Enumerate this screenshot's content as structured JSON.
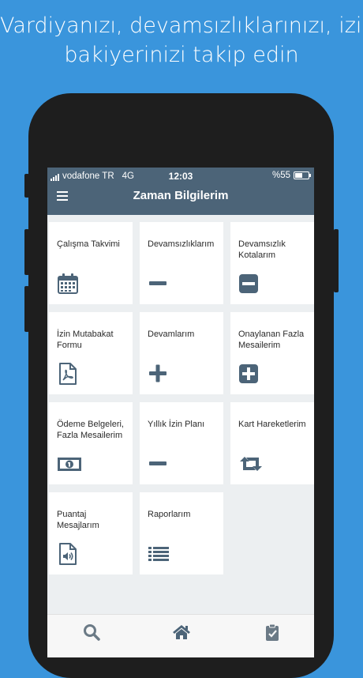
{
  "promo": {
    "line1": "Vardiyanızı, devamsızlıklarınızı, izin",
    "line2": "bakiyerinizi takip edin"
  },
  "status_bar": {
    "carrier": "vodafone TR",
    "network": "4G",
    "time": "12:03",
    "battery": "%55",
    "battery_level": 0.55
  },
  "header": {
    "title": "Zaman Bilgilerim",
    "menu_icon": "hamburger-icon"
  },
  "colors": {
    "background": "#3a95dc",
    "header": "#4c6478",
    "icon": "#4c6478"
  },
  "tiles": [
    {
      "label": "Çalışma Takvimi",
      "icon": "calendar-icon"
    },
    {
      "label": "Devamsızlıklarım",
      "icon": "minus-icon"
    },
    {
      "label": "Devamsızlık Kotalarım",
      "icon": "minus-square-icon"
    },
    {
      "label": "İzin Mutabakat Formu",
      "icon": "pdf-file-icon"
    },
    {
      "label": "Devamlarım",
      "icon": "plus-icon"
    },
    {
      "label": "Onaylanan Fazla Mesailerim",
      "icon": "plus-square-icon"
    },
    {
      "label": "Ödeme Belgeleri, Fazla Mesailerim",
      "icon": "money-bill-icon"
    },
    {
      "label": "Yıllık İzin Planı",
      "icon": "minus-icon"
    },
    {
      "label": "Kart Hareketlerim",
      "icon": "retweet-icon"
    },
    {
      "label": "Puantaj Mesajlarım",
      "icon": "audio-file-icon"
    },
    {
      "label": "Raporlarım",
      "icon": "list-icon"
    }
  ],
  "tab_bar": [
    {
      "icon": "search-icon"
    },
    {
      "icon": "home-icon"
    },
    {
      "icon": "clipboard-check-icon"
    }
  ]
}
